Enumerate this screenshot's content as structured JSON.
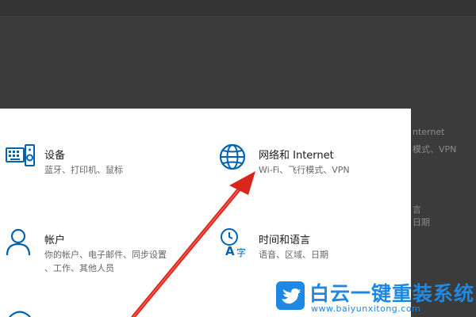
{
  "background_window": {
    "peek_lines": [
      "nternet",
      "模式、VPN",
      "言",
      "日期"
    ]
  },
  "tiles": [
    {
      "title": "设备",
      "desc_lines": [
        "蓝牙、打印机、鼠标"
      ],
      "icon": "keyboard-speaker-icon"
    },
    {
      "title": "网络和 Internet",
      "desc_lines": [
        "Wi-Fi、飞行模式、VPN"
      ],
      "icon": "globe-icon"
    },
    {
      "title": "帐户",
      "desc_lines": [
        "你的帐户、电子邮件、同步设置",
        "、工作、其他人员"
      ],
      "icon": "person-icon"
    },
    {
      "title": "时间和语言",
      "desc_lines": [
        "语音、区域、日期"
      ],
      "icon": "time-language-icon"
    }
  ],
  "watermark": {
    "brand_cn": "白云一键重装系统",
    "url": "www.baiyunxitong.com",
    "icon": "bird-icon"
  },
  "colors": {
    "icon_blue": "#0063b1",
    "arrow_red": "#d9261c",
    "watermark_blue": "#1e88e5"
  }
}
